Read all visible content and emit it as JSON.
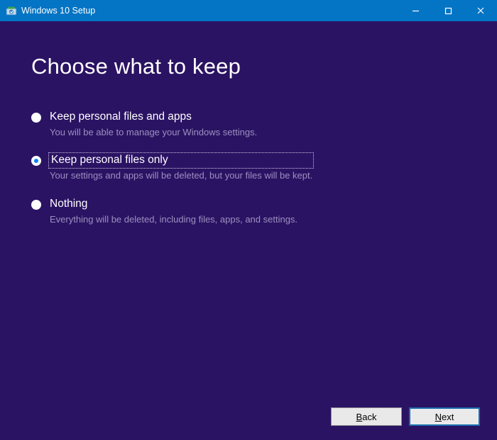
{
  "window": {
    "title": "Windows 10 Setup",
    "controls": {
      "minimize": "minimize",
      "maximize": "maximize",
      "close": "close"
    }
  },
  "page": {
    "heading": "Choose what to keep"
  },
  "options": [
    {
      "id": "keep-files-and-apps",
      "label": "Keep personal files and apps",
      "description": "You will be able to manage your Windows settings.",
      "selected": false,
      "focused": false
    },
    {
      "id": "keep-files-only",
      "label": "Keep personal files only",
      "description": "Your settings and apps will be deleted, but your files will be kept.",
      "selected": true,
      "focused": true
    },
    {
      "id": "nothing",
      "label": "Nothing",
      "description": "Everything will be deleted, including files, apps, and settings.",
      "selected": false,
      "focused": false
    }
  ],
  "footer": {
    "back_label": "Back",
    "next_label": "Next"
  }
}
